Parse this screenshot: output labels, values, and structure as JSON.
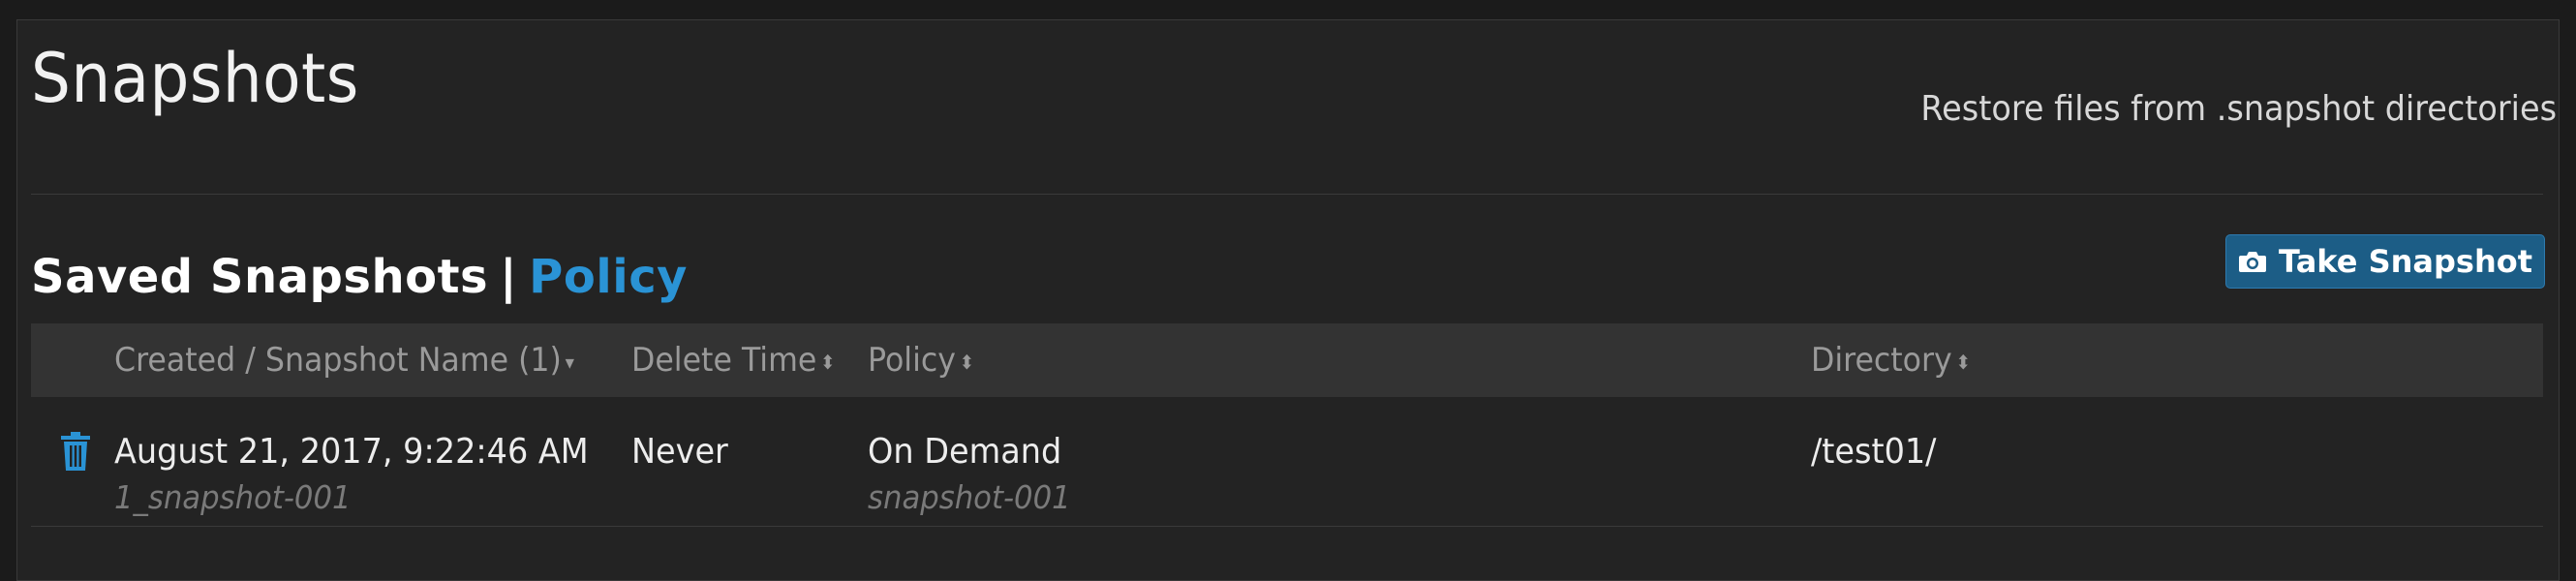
{
  "page": {
    "title": "Snapshots",
    "subtitle": "Restore files from .snapshot directories"
  },
  "section": {
    "title": "Saved Snapshots",
    "separator": "|",
    "policy_link": "Policy"
  },
  "toolbar": {
    "take_snapshot_label": "Take Snapshot",
    "take_snapshot_icon": "camera-icon"
  },
  "table": {
    "columns": [
      {
        "label": "Created / Snapshot Name (1)",
        "sort": "desc"
      },
      {
        "label": "Delete Time",
        "sort": "both"
      },
      {
        "label": "Policy",
        "sort": "both"
      },
      {
        "label": "Directory",
        "sort": "both"
      }
    ],
    "rows": [
      {
        "created": "August 21, 2017, 9:22:46 AM",
        "name": "1_snapshot-001",
        "delete_time": "Never",
        "policy": "On Demand",
        "policy_sub": "snapshot-001",
        "directory": "/test01/",
        "action_icon": "trash-icon"
      }
    ]
  },
  "colors": {
    "accent": "#2a93d5",
    "button_bg": "#1c5d86",
    "panel_bg": "#232323",
    "header_bg": "#333333"
  }
}
